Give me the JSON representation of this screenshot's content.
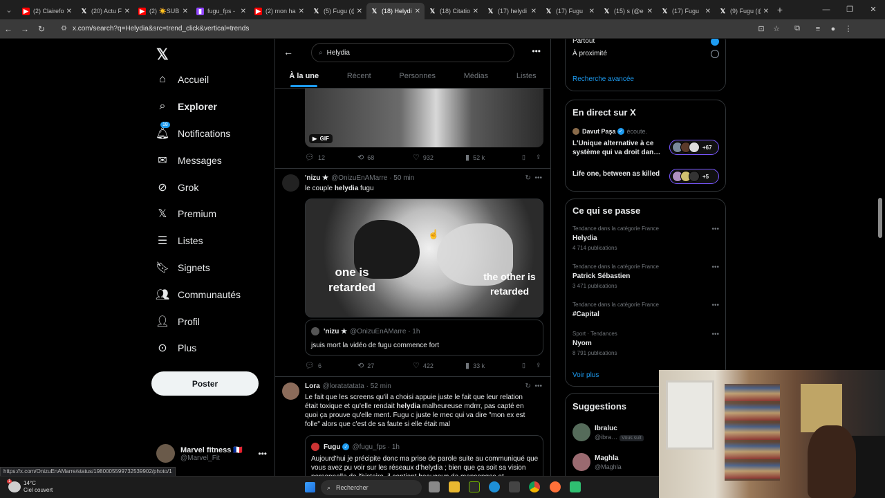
{
  "browser": {
    "tabs": [
      {
        "title": "(2) Clairefo",
        "icon": "youtube-icon",
        "color": "#ff0000"
      },
      {
        "title": "(20) Actu F",
        "icon": "x-logo-icon",
        "color": "#ffffff"
      },
      {
        "title": "(2) ☀️SUB",
        "icon": "youtube-icon",
        "color": "#ff0000"
      },
      {
        "title": "fugu_fps -",
        "icon": "twitch-icon",
        "color": "#9146ff"
      },
      {
        "title": "(2) mon ha",
        "icon": "youtube-icon",
        "color": "#ff0000"
      },
      {
        "title": "(5) Fugu (@",
        "icon": "x-logo-icon",
        "color": "#ffffff"
      },
      {
        "title": "(18) Helydi",
        "icon": "x-logo-icon",
        "color": "#ffffff",
        "active": true
      },
      {
        "title": "(18) Citatio",
        "icon": "x-logo-icon",
        "color": "#ffffff"
      },
      {
        "title": "(17) helydi",
        "icon": "x-logo-icon",
        "color": "#ffffff"
      },
      {
        "title": "(17) Fugu",
        "icon": "x-logo-icon",
        "color": "#ffffff"
      },
      {
        "title": "(15) s (@e",
        "icon": "x-logo-icon",
        "color": "#ffffff"
      },
      {
        "title": "(17) Fugu",
        "icon": "x-logo-icon",
        "color": "#ffffff"
      },
      {
        "title": "(9) Fugu (@",
        "icon": "x-logo-icon",
        "color": "#ffffff"
      }
    ],
    "url": "x.com/search?q=Helydia&src=trend_click&vertical=trends",
    "status_url": "https://x.com/OnizuEnAMarre/status/1980005599732539902/photo/1"
  },
  "sidebar": {
    "items": [
      {
        "label": "Accueil",
        "icon": "home-icon"
      },
      {
        "label": "Explorer",
        "icon": "search-icon",
        "active": true
      },
      {
        "label": "Notifications",
        "icon": "bell-icon",
        "badge": "18"
      },
      {
        "label": "Messages",
        "icon": "mail-icon"
      },
      {
        "label": "Grok",
        "icon": "grok-icon"
      },
      {
        "label": "Premium",
        "icon": "x-logo-icon"
      },
      {
        "label": "Listes",
        "icon": "list-icon"
      },
      {
        "label": "Signets",
        "icon": "bookmark-icon"
      },
      {
        "label": "Communautés",
        "icon": "communities-icon"
      },
      {
        "label": "Profil",
        "icon": "profile-icon"
      },
      {
        "label": "Plus",
        "icon": "more-circle-icon"
      }
    ],
    "post_button": "Poster",
    "account": {
      "name": "Marvel fitness 🇫🇷",
      "handle": "@Marvel_Fit"
    }
  },
  "search": {
    "query": "Helydia",
    "tabs": [
      "À la une",
      "Récent",
      "Personnes",
      "Médias",
      "Listes"
    ],
    "active_tab": "À la une"
  },
  "feed": {
    "first_tweet": {
      "gif_label": "GIF",
      "replies": "12",
      "reposts": "68",
      "likes": "932",
      "views": "52 k"
    },
    "second_tweet": {
      "name": "'nizu ★",
      "handle": "@OnizuEnAMarre",
      "time": "· 50 min",
      "text_before": "le couple ",
      "text_bold": "helydia",
      "text_after": " fugu",
      "meme_left": "one is retarded",
      "meme_right": "the other is retarded",
      "quote": {
        "name": "'nizu ★",
        "handle": "@OnizuEnAMarre",
        "time": "· 1h",
        "text": "jsuis mort la vidéo de fugu commence fort"
      },
      "replies": "6",
      "reposts": "27",
      "likes": "422",
      "views": "33 k"
    },
    "third_tweet": {
      "name": "Lora",
      "handle": "@loratatatata",
      "time": "· 52 min",
      "text_1": "Le fait que les screens qu'il a choisi appuie juste le fait que leur relation était toxique et qu'elle rendait ",
      "text_bold": "helydia",
      "text_2": " malheureuse mdrrr, pas capté en quoi ça prouve qu'elle ment. Fugu c juste le mec qui va dire \"mon ex est folle\" alors que c'est de sa faute si elle était mal",
      "quote": {
        "name": "Fugu",
        "handle": "@fugu_fps",
        "time": "· 1h",
        "text": "Aujourd'hui je précipite donc ma prise de parole suite au communiqué que vous avez pu voir sur les réseaux d'helydia ; bien que ça soit sa vision personnelle de l'histoire, il contient beaucoup de mensonges et"
      }
    }
  },
  "right": {
    "location": {
      "options": [
        "Partout",
        "À proximité"
      ],
      "selected": "Partout",
      "advanced": "Recherche avancée"
    },
    "live": {
      "title": "En direct sur X",
      "host": "Davut Paşa",
      "host_action": "écoute.",
      "spaces": [
        {
          "title": "L'Unique alternative à ce système qui va droit dan…",
          "count": "+67"
        },
        {
          "title": "Life one, between as killed",
          "count": "+5"
        }
      ]
    },
    "trends": {
      "title": "Ce qui se passe",
      "items": [
        {
          "category": "Tendance dans la catégorie France",
          "name": "Helydia",
          "count": "4 714 publications"
        },
        {
          "category": "Tendance dans la catégorie France",
          "name": "Patrick Sébastien",
          "count": "3 471 publications"
        },
        {
          "category": "Tendance dans la catégorie France",
          "name": "#Capital",
          "count": ""
        },
        {
          "category": "Sport · Tendances",
          "name": "Nyom",
          "count": "8 791 publications"
        }
      ],
      "more": "Voir plus"
    },
    "suggestions": {
      "title": "Suggestions",
      "items": [
        {
          "name": "Ibraluc",
          "handle": "@ibra…",
          "tag": "Vous suit"
        },
        {
          "name": "Maghla",
          "handle": "@Maghla",
          "tag": ""
        }
      ]
    }
  },
  "taskbar": {
    "temp": "14°C",
    "weather": "Ciel couvert",
    "weather_badge": "1",
    "search": "Rechercher"
  },
  "colors": {
    "accent": "#1d9bf0",
    "bg": "#000000",
    "border": "#2f3336",
    "muted": "#71767b"
  }
}
